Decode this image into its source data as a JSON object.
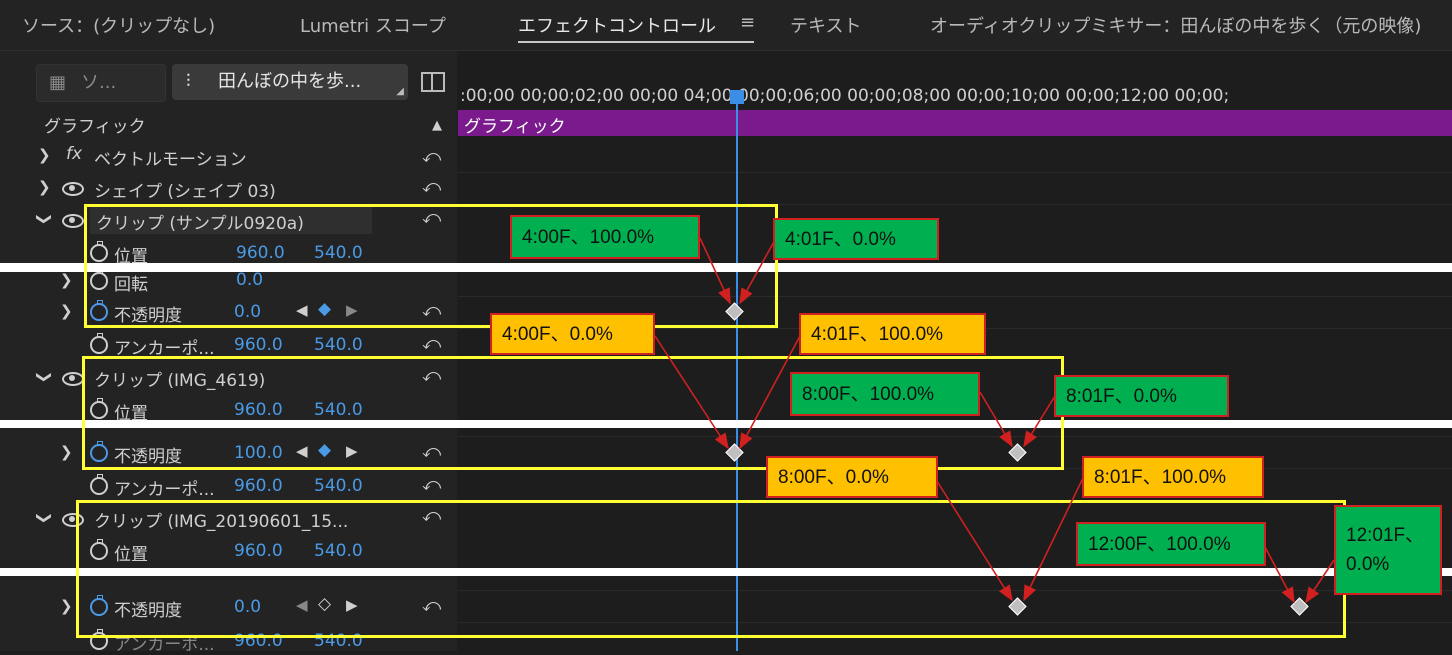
{
  "tabs": [
    "ソース：(クリップなし)",
    "Lumetri スコープ",
    "エフェクトコントロール",
    "≡",
    "テキスト",
    "オーディオクリップミキサー：田んぼの中を歩く（元の映像)"
  ],
  "source_chip": "ソ...",
  "sequence_chip": "田んぼの中を歩...",
  "section_label": "グラフィック",
  "timecode_ruler": ":00;00 00;00;02;00 00;00 04;00 00;00;06;00 00;00;08;00 00;00;10;00 00;00;12;00 00;00;",
  "ruler": [
    ":00;00",
    "00;00;02;00",
    "00;00",
    "04;00",
    "00;00;06;00",
    "00;00;08;00",
    "00;00;10;00",
    "00;00;12;00",
    "00;00;"
  ],
  "clip_bar_label": "グラフィック",
  "rows": {
    "vector_motion": "ベクトルモーション",
    "shape": "シェイプ (シェイプ 03)",
    "clip1": "クリップ (サンプル0920a)",
    "clip2": "クリップ (IMG_4619)",
    "clip3": "クリップ (IMG_20190601_15...",
    "position": "位置",
    "rotation": "回転",
    "opacity": "不透明度",
    "anchor": "アンカーポ...",
    "fx": "fx"
  },
  "values": {
    "pos_x": "960.0",
    "pos_y": "540.0",
    "rot": "0.0",
    "op1": "0.0",
    "op2": "100.0",
    "op3": "0.0"
  },
  "callouts": {
    "c1": "4:00F、100.0%",
    "c2": "4:01F、0.0%",
    "c3": "4:00F、0.0%",
    "c4": "4:01F、100.0%",
    "c5": "8:00F、100.0%",
    "c6": "8:01F、0.0%",
    "c7": "8:00F、0.0%",
    "c8": "8:01F、100.0%",
    "c9": "12:00F、100.0%",
    "c10": "12:01F、",
    "c10b": "0.0%"
  },
  "colors": {
    "accent_blue": "#4a9ae6",
    "clip_bar": "#7a1a8c",
    "callout_green": "#00b050",
    "callout_orange": "#ffc000",
    "highlight_yellow": "#ffff33",
    "arrow_red": "#d02020"
  }
}
